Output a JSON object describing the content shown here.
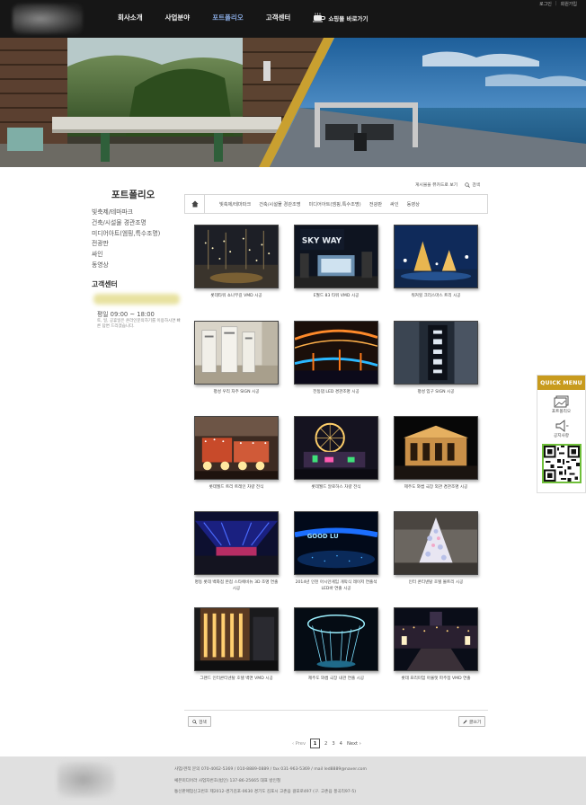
{
  "header": {
    "util_links": [
      "로그인",
      "회원가입"
    ],
    "util_sep": "|",
    "nav": [
      {
        "label": "회사소개",
        "active": false
      },
      {
        "label": "사업분야",
        "active": false
      },
      {
        "label": "포트폴리오",
        "active": true
      },
      {
        "label": "고객센터",
        "active": false
      }
    ],
    "shop_label": "쇼핑몰 바로가기"
  },
  "sidebar": {
    "title": "포트폴리오",
    "items": [
      "빛축제/테마파크",
      "건축/시설물 경관조명",
      "미디어아트(엠핑,특수조명)",
      "전광판",
      "싸인",
      "동영상"
    ],
    "cs_title": "고객센터",
    "hours": "평일 09:00 ~ 18:00",
    "note": "토, 일, 공휴일은 온라인문의하기를 이용하시면 빠른 답변 드리겠습니다."
  },
  "toolbar": {
    "view_toggle": "게시물을 뷰카드로 보기",
    "search_label": "검색"
  },
  "categories": [
    "빛축제/테마파크",
    "건축/시설물 경관조명",
    "미디어아트(엠핑,특수조명)",
    "전광판",
    "싸인",
    "동영상"
  ],
  "portfolio": [
    {
      "caption": "롯데타워 쇼나무길 VMD 시공",
      "icon": "night-street-lights"
    },
    {
      "caption": "E월드 83 타워 VMD 시공",
      "icon": "tower-sign"
    },
    {
      "caption": "워커힐 크리스마스 트리 시공",
      "icon": "christmas-tree"
    },
    {
      "caption": "평성 우리 자주 SIGN 시공",
      "icon": "sign-panels"
    },
    {
      "caption": "전동댐 LED 경관조명 시공",
      "icon": "led-bridge"
    },
    {
      "caption": "평성 입구 SIGN 시공",
      "icon": "vertical-sign"
    },
    {
      "caption": "롯데월드 트리 트레인 차량 전식",
      "icon": "light-train"
    },
    {
      "caption": "롯데월드 알로하스 차량 전식",
      "icon": "light-carnival"
    },
    {
      "caption": "제주도 와썹 극장 외관 경관조명 시공",
      "icon": "lit-building"
    },
    {
      "caption": "명동 롯데 백화점 본점 스타에비뉴 3D 조명 연출 시공",
      "icon": "tunnel-lights"
    },
    {
      "caption": "2014년 인천 아시안게임 개막식 레이저 연출석 LED바 연출 시공",
      "icon": "stadium-led"
    },
    {
      "caption": "인터 콘티넨탈 호텔 볼트리 시공",
      "icon": "ball-tree"
    },
    {
      "caption": "그랜드 인터콘티넨탈 호텔 벽면 VMD 시공",
      "icon": "hotel-facade"
    },
    {
      "caption": "제주도 와썹 극장 내관 연출 시공",
      "icon": "light-tree-sculpture"
    },
    {
      "caption": "롯데 프리미엄 아울렛 파주점 VMD 연출",
      "icon": "outlet-night"
    }
  ],
  "actions": {
    "search_label": "검색",
    "write_label": "글쓰기"
  },
  "pagination": {
    "prev": "‹ Prev",
    "pages": [
      "1",
      "2",
      "3",
      "4"
    ],
    "current": "1",
    "next": "Next ›"
  },
  "footer": {
    "lines": [
      "사업/견적 문의 070-4062-5369 / 010-8889-0889 / fax 031-963-5369 / mail led8889@naver.com",
      "쎄븐미디어라 사업자번호(법인) 137-86-25665 대표 방인철",
      "통신판매업신고번호 제2012-경기김포-0630 경기도 김포시 고촌읍 걸포로497 (구. 고촌읍 풍곡리97-5)"
    ]
  },
  "quick_menu": {
    "title": "QUICK MENU",
    "items": [
      {
        "label": "포트폴리오",
        "icon": "portfolio-icon"
      },
      {
        "label": "공지사항",
        "icon": "megaphone-icon"
      }
    ]
  },
  "colors": {
    "topbar": "#161616",
    "accent_gold": "#c89b1e",
    "nav_active": "#88a9e0",
    "qr_border": "#6fbf3a"
  }
}
